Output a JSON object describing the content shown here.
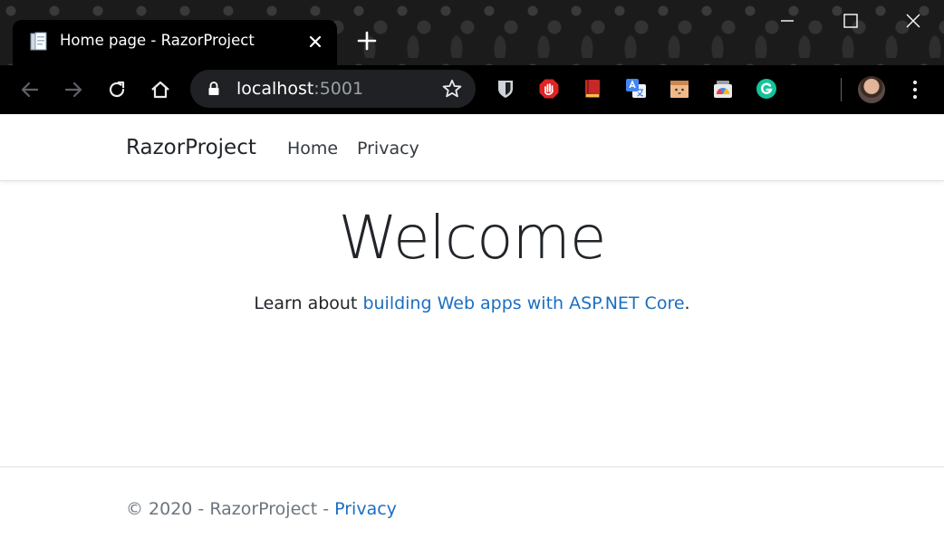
{
  "browser": {
    "tab_title": "Home page - RazorProject",
    "url_host": "localhost",
    "url_port": ":5001",
    "icons": {
      "favicon": "document-icon",
      "close": "close-icon",
      "new_tab": "plus-icon",
      "back": "back-arrow-icon",
      "forward": "forward-arrow-icon",
      "reload": "reload-icon",
      "home": "home-icon",
      "lock": "lock-icon",
      "bookmark": "star-icon",
      "menu": "vertical-dots-icon"
    },
    "extensions": [
      "bitwarden-icon",
      "adblock-icon",
      "reader-icon",
      "translate-icon",
      "cookie-icon",
      "chrome-icon",
      "grammarly-icon"
    ]
  },
  "site": {
    "brand": "RazorProject",
    "nav": [
      "Home",
      "Privacy"
    ]
  },
  "main": {
    "heading": "Welcome",
    "lead_prefix": "Learn about ",
    "lead_link": "building Web apps with ASP.NET Core",
    "lead_suffix": "."
  },
  "footer": {
    "text": "© 2020 - RazorProject - ",
    "link": "Privacy"
  },
  "colors": {
    "link": "#1b6ec2",
    "chrome_bg": "#000000",
    "omnibox_bg": "#202124"
  }
}
